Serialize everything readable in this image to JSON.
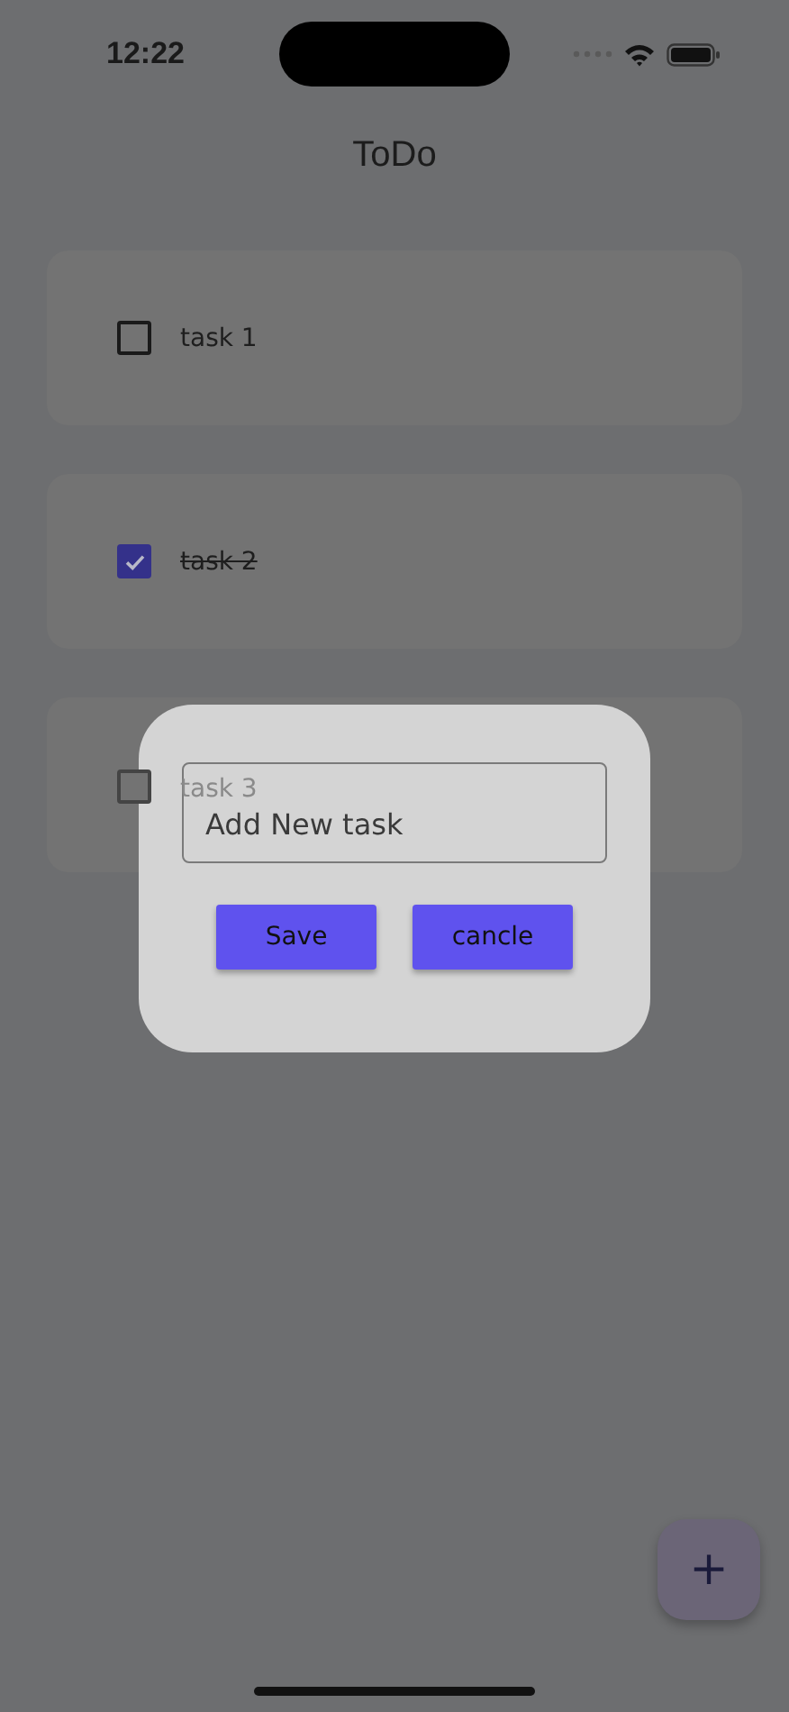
{
  "status_bar": {
    "time": "12:22"
  },
  "app_bar": {
    "title": "ToDo"
  },
  "tasks": [
    {
      "label": "task 1",
      "checked": false
    },
    {
      "label": "task 2",
      "checked": true
    },
    {
      "label": "task 3",
      "checked": false
    }
  ],
  "dialog": {
    "field": {
      "placeholder": "Add New task"
    },
    "buttons": [
      "Save",
      "cancle"
    ]
  },
  "fab": {
    "icon": "+"
  }
}
